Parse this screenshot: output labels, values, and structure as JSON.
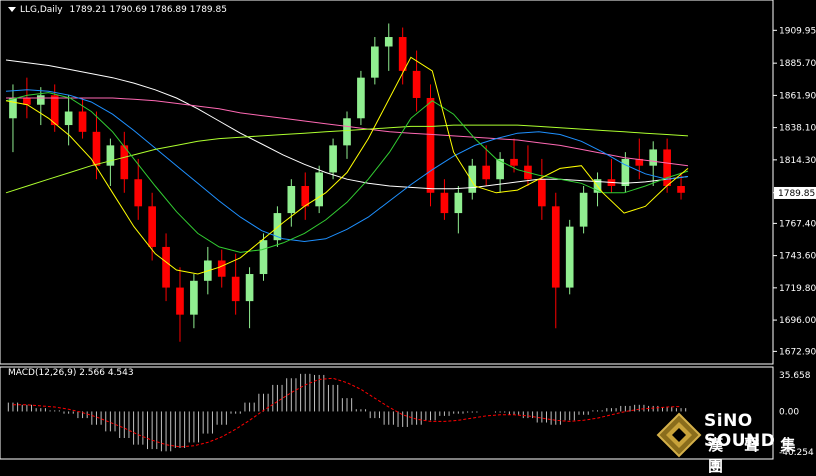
{
  "header": {
    "symbol": "LLG,Daily",
    "ohlc": "1789.21 1790.69 1786.89 1789.85"
  },
  "macd": {
    "label": "MACD(12,26,9) 2.566 4.543",
    "ticks": [
      "35.658",
      "0.00",
      "-40.254"
    ]
  },
  "logo": {
    "name": "SiNO SOUND",
    "chinese": "漢 聲 集 團"
  },
  "colors": {
    "background": "#000000",
    "bull": "#90EE90",
    "bear": "#FF0000",
    "macd_hist": "#C0C0C0",
    "macd_signal": "#FF0000"
  },
  "chart_data": [
    {
      "type": "candlestick",
      "title": "LLG,Daily",
      "ylim": [
        1668,
        1922
      ],
      "yticks": [
        "1909.95",
        "1885.70",
        "1861.90",
        "1838.10",
        "1814.30",
        "1790.05",
        "1767.40",
        "1743.60",
        "1719.80",
        "1696.00",
        "1672.90"
      ],
      "last_price": "1789.85",
      "grid": false,
      "series": [
        {
          "color": "#FFFFFF",
          "values": [
            1888,
            1886,
            1884,
            1881,
            1878,
            1875,
            1871,
            1866,
            1860,
            1852,
            1843,
            1834,
            1826,
            1818,
            1811,
            1805,
            1800,
            1797,
            1795,
            1794,
            1793,
            1793,
            1794,
            1796,
            1798,
            1800,
            1800,
            1799,
            1798,
            1797,
            1798,
            1800,
            1802
          ]
        },
        {
          "color": "#FF69B4",
          "values": [
            1860,
            1860,
            1860,
            1860,
            1860,
            1860,
            1859,
            1858,
            1856,
            1854,
            1852,
            1849,
            1847,
            1845,
            1843,
            1841,
            1839,
            1837,
            1835,
            1834,
            1833,
            1832,
            1831,
            1830,
            1829,
            1827,
            1825,
            1822,
            1819,
            1816,
            1814,
            1812,
            1810
          ]
        },
        {
          "color": "#1E90FF",
          "values": [
            1865,
            1866,
            1865,
            1862,
            1857,
            1848,
            1836,
            1823,
            1810,
            1797,
            1784,
            1772,
            1762,
            1756,
            1754,
            1756,
            1763,
            1772,
            1784,
            1796,
            1807,
            1817,
            1825,
            1830,
            1834,
            1835,
            1833,
            1828,
            1820,
            1811,
            1804,
            1800,
            1802
          ]
        },
        {
          "color": "#ADFF2F",
          "values": [
            1790,
            1795,
            1800,
            1805,
            1810,
            1814,
            1818,
            1822,
            1825,
            1828,
            1830,
            1831,
            1832,
            1833,
            1834,
            1835,
            1836,
            1837,
            1838,
            1839,
            1839,
            1840,
            1840,
            1840,
            1840,
            1839,
            1838,
            1837,
            1836,
            1835,
            1834,
            1833,
            1832
          ]
        },
        {
          "color": "#32CD32",
          "values": [
            1858,
            1862,
            1864,
            1860,
            1850,
            1835,
            1815,
            1795,
            1776,
            1760,
            1750,
            1746,
            1748,
            1753,
            1760,
            1770,
            1783,
            1800,
            1820,
            1845,
            1858,
            1848,
            1830,
            1815,
            1807,
            1803,
            1800,
            1797,
            1790,
            1790,
            1795,
            1801,
            1806
          ]
        },
        {
          "color": "#FFFF00",
          "values": [
            1858,
            1855,
            1845,
            1832,
            1815,
            1790,
            1765,
            1745,
            1733,
            1730,
            1735,
            1742,
            1755,
            1768,
            1780,
            1790,
            1805,
            1830,
            1860,
            1890,
            1880,
            1820,
            1795,
            1790,
            1792,
            1800,
            1808,
            1810,
            1790,
            1775,
            1780,
            1795,
            1808
          ]
        }
      ],
      "candles": [
        {
          "o": 1845,
          "h": 1870,
          "l": 1820,
          "c": 1860
        },
        {
          "o": 1860,
          "h": 1875,
          "l": 1845,
          "c": 1855
        },
        {
          "o": 1855,
          "h": 1868,
          "l": 1840,
          "c": 1862
        },
        {
          "o": 1862,
          "h": 1870,
          "l": 1835,
          "c": 1840
        },
        {
          "o": 1840,
          "h": 1862,
          "l": 1825,
          "c": 1850
        },
        {
          "o": 1850,
          "h": 1860,
          "l": 1830,
          "c": 1835
        },
        {
          "o": 1835,
          "h": 1850,
          "l": 1800,
          "c": 1810
        },
        {
          "o": 1810,
          "h": 1830,
          "l": 1795,
          "c": 1825
        },
        {
          "o": 1825,
          "h": 1835,
          "l": 1790,
          "c": 1800
        },
        {
          "o": 1800,
          "h": 1815,
          "l": 1770,
          "c": 1780
        },
        {
          "o": 1780,
          "h": 1790,
          "l": 1740,
          "c": 1750
        },
        {
          "o": 1750,
          "h": 1760,
          "l": 1710,
          "c": 1720
        },
        {
          "o": 1720,
          "h": 1735,
          "l": 1680,
          "c": 1700
        },
        {
          "o": 1700,
          "h": 1730,
          "l": 1690,
          "c": 1725
        },
        {
          "o": 1725,
          "h": 1750,
          "l": 1715,
          "c": 1740
        },
        {
          "o": 1740,
          "h": 1748,
          "l": 1720,
          "c": 1728
        },
        {
          "o": 1728,
          "h": 1745,
          "l": 1700,
          "c": 1710
        },
        {
          "o": 1710,
          "h": 1735,
          "l": 1690,
          "c": 1730
        },
        {
          "o": 1730,
          "h": 1760,
          "l": 1725,
          "c": 1755
        },
        {
          "o": 1755,
          "h": 1780,
          "l": 1750,
          "c": 1775
        },
        {
          "o": 1775,
          "h": 1800,
          "l": 1765,
          "c": 1795
        },
        {
          "o": 1795,
          "h": 1805,
          "l": 1770,
          "c": 1780
        },
        {
          "o": 1780,
          "h": 1810,
          "l": 1775,
          "c": 1805
        },
        {
          "o": 1805,
          "h": 1830,
          "l": 1800,
          "c": 1825
        },
        {
          "o": 1825,
          "h": 1850,
          "l": 1815,
          "c": 1845
        },
        {
          "o": 1845,
          "h": 1880,
          "l": 1840,
          "c": 1875
        },
        {
          "o": 1875,
          "h": 1905,
          "l": 1870,
          "c": 1898
        },
        {
          "o": 1898,
          "h": 1915,
          "l": 1880,
          "c": 1905
        },
        {
          "o": 1905,
          "h": 1912,
          "l": 1870,
          "c": 1880
        },
        {
          "o": 1880,
          "h": 1895,
          "l": 1850,
          "c": 1860
        },
        {
          "o": 1860,
          "h": 1870,
          "l": 1780,
          "c": 1790
        },
        {
          "o": 1790,
          "h": 1800,
          "l": 1770,
          "c": 1775
        },
        {
          "o": 1775,
          "h": 1795,
          "l": 1760,
          "c": 1790
        },
        {
          "o": 1790,
          "h": 1815,
          "l": 1785,
          "c": 1810
        },
        {
          "o": 1810,
          "h": 1825,
          "l": 1795,
          "c": 1800
        },
        {
          "o": 1800,
          "h": 1820,
          "l": 1790,
          "c": 1815
        },
        {
          "o": 1815,
          "h": 1830,
          "l": 1805,
          "c": 1810
        },
        {
          "o": 1810,
          "h": 1825,
          "l": 1795,
          "c": 1800
        },
        {
          "o": 1800,
          "h": 1815,
          "l": 1770,
          "c": 1780
        },
        {
          "o": 1780,
          "h": 1790,
          "l": 1690,
          "c": 1720
        },
        {
          "o": 1720,
          "h": 1770,
          "l": 1715,
          "c": 1765
        },
        {
          "o": 1765,
          "h": 1795,
          "l": 1760,
          "c": 1790
        },
        {
          "o": 1790,
          "h": 1805,
          "l": 1780,
          "c": 1800
        },
        {
          "o": 1800,
          "h": 1815,
          "l": 1790,
          "c": 1795
        },
        {
          "o": 1795,
          "h": 1820,
          "l": 1790,
          "c": 1815
        },
        {
          "o": 1815,
          "h": 1830,
          "l": 1800,
          "c": 1810
        },
        {
          "o": 1810,
          "h": 1828,
          "l": 1795,
          "c": 1822
        },
        {
          "o": 1822,
          "h": 1830,
          "l": 1790,
          "c": 1795
        },
        {
          "o": 1795,
          "h": 1805,
          "l": 1785,
          "c": 1790
        }
      ]
    },
    {
      "type": "bar",
      "title": "MACD(12,26,9) 2.566 4.543",
      "ylim": [
        -40.254,
        35.658
      ],
      "values": [
        8,
        6,
        3,
        1,
        -2,
        -6,
        -12,
        -18,
        -24,
        -30,
        -34,
        -36,
        -33,
        -28,
        -20,
        -12,
        -2,
        8,
        16,
        24,
        30,
        34,
        33,
        24,
        12,
        2,
        -6,
        -12,
        -14,
        -12,
        -8,
        -4,
        -2,
        -1,
        0,
        -1,
        -3,
        -6,
        -10,
        -12,
        -8,
        -3,
        1,
        3,
        5,
        6,
        5,
        4,
        3
      ],
      "signal": [
        6,
        6,
        5,
        4,
        2,
        -1,
        -5,
        -10,
        -15,
        -21,
        -26,
        -30,
        -32,
        -31,
        -28,
        -23,
        -16,
        -8,
        1,
        9,
        17,
        24,
        29,
        30,
        26,
        20,
        12,
        4,
        -3,
        -7,
        -9,
        -9,
        -8,
        -6,
        -4,
        -3,
        -3,
        -4,
        -6,
        -8,
        -9,
        -8,
        -6,
        -3,
        0,
        2,
        3,
        4,
        4.5
      ]
    }
  ]
}
